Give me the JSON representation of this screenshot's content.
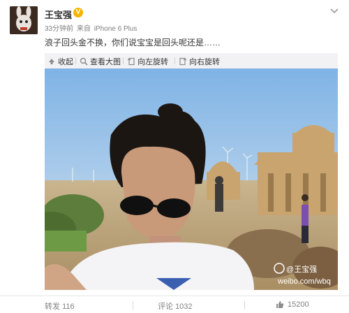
{
  "post": {
    "username": "王宝强",
    "verified_badge": "V",
    "time": "33分钟前",
    "source_prefix": "来自",
    "source": "iPhone 6 Plus",
    "text": "浪子回头金不换，你们说宝宝是回头呢还是……"
  },
  "toolbar": {
    "collapse_label": "收起",
    "view_large_label": "查看大图",
    "rotate_left_label": "向左旋转",
    "rotate_right_label": "向右旋转"
  },
  "photo": {
    "watermark_handle": "@王宝强",
    "watermark_site": "weibo.com/wbq"
  },
  "footer": {
    "repost_label": "转发",
    "repost_count": "116",
    "comment_label": "评论",
    "comment_count": "1032",
    "like_count": "15200"
  },
  "colors": {
    "accent": "#eb7350",
    "verified": "#f7b500",
    "toolbar_bg": "#f2f2f5",
    "meta_text": "#808080"
  },
  "icons": [
    "chevron-down-icon",
    "collapse-arrow-icon",
    "zoom-icon",
    "rotate-left-icon",
    "rotate-right-icon",
    "thumbs-up-icon"
  ]
}
